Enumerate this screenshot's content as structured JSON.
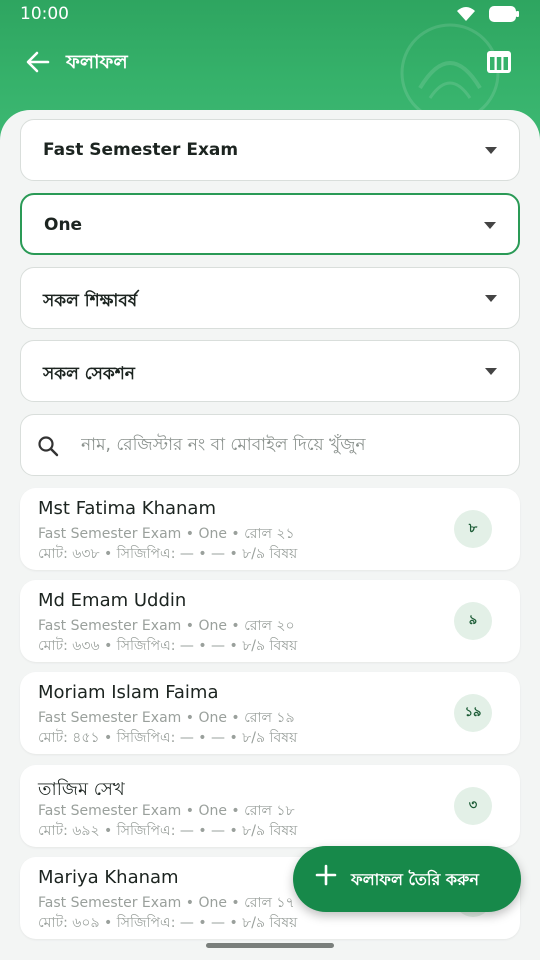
{
  "status_bar": {
    "time": "10:00"
  },
  "app_bar": {
    "title": "ফলাফল"
  },
  "filters": {
    "exam": "Fast Semester Exam",
    "class": "One",
    "year": "সকল শিক্ষাবর্ষ",
    "section": "সকল সেকশন"
  },
  "search": {
    "placeholder": "নাম, রেজিস্টার নং বা মোবাইল দিয়ে খুঁজুন",
    "value": ""
  },
  "results": [
    {
      "name": "Mst Fatima Khanam",
      "meta1": "Fast Semester Exam • One • রোল ২১",
      "meta2": "মোট: ৬৩৮ • সিজিপিএ: — • — • ৮/৯ বিষয়",
      "badge": "৮"
    },
    {
      "name": "Md Emam Uddin",
      "meta1": "Fast Semester Exam • One • রোল ২০",
      "meta2": "মোট: ৬৩৬ • সিজিপিএ: — • — • ৮/৯ বিষয়",
      "badge": "৯"
    },
    {
      "name": "Moriam Islam Faima",
      "meta1": "Fast Semester Exam • One • রোল ১৯",
      "meta2": "মোট: ৪৫১ • সিজিপিএ: — • — • ৮/৯ বিষয়",
      "badge": "১৯"
    },
    {
      "name": "তাজিম সেখ",
      "meta1": "Fast Semester Exam • One • রোল ১৮",
      "meta2": "মোট: ৬৯২ • সিজিপিএ: — • — • ৮/৯ বিষয়",
      "badge": "৩"
    },
    {
      "name": "Mariya Khanam",
      "meta1": "Fast Semester Exam • One • রোল ১৭",
      "meta2": "মোট: ৬০৯ • সিজিপিএ: — • — • ৮/৯ বিষয়",
      "badge": ""
    }
  ],
  "fab": {
    "label": "ফলাফল তৈরি করুন"
  },
  "colors": {
    "header": "#36b26b",
    "accent": "#17894a",
    "background": "#f3f5f4"
  },
  "icons": [
    "back-arrow-icon",
    "table-icon",
    "wifi-icon",
    "battery-icon",
    "search-icon",
    "dropdown-arrow-icon",
    "plus-icon"
  ]
}
